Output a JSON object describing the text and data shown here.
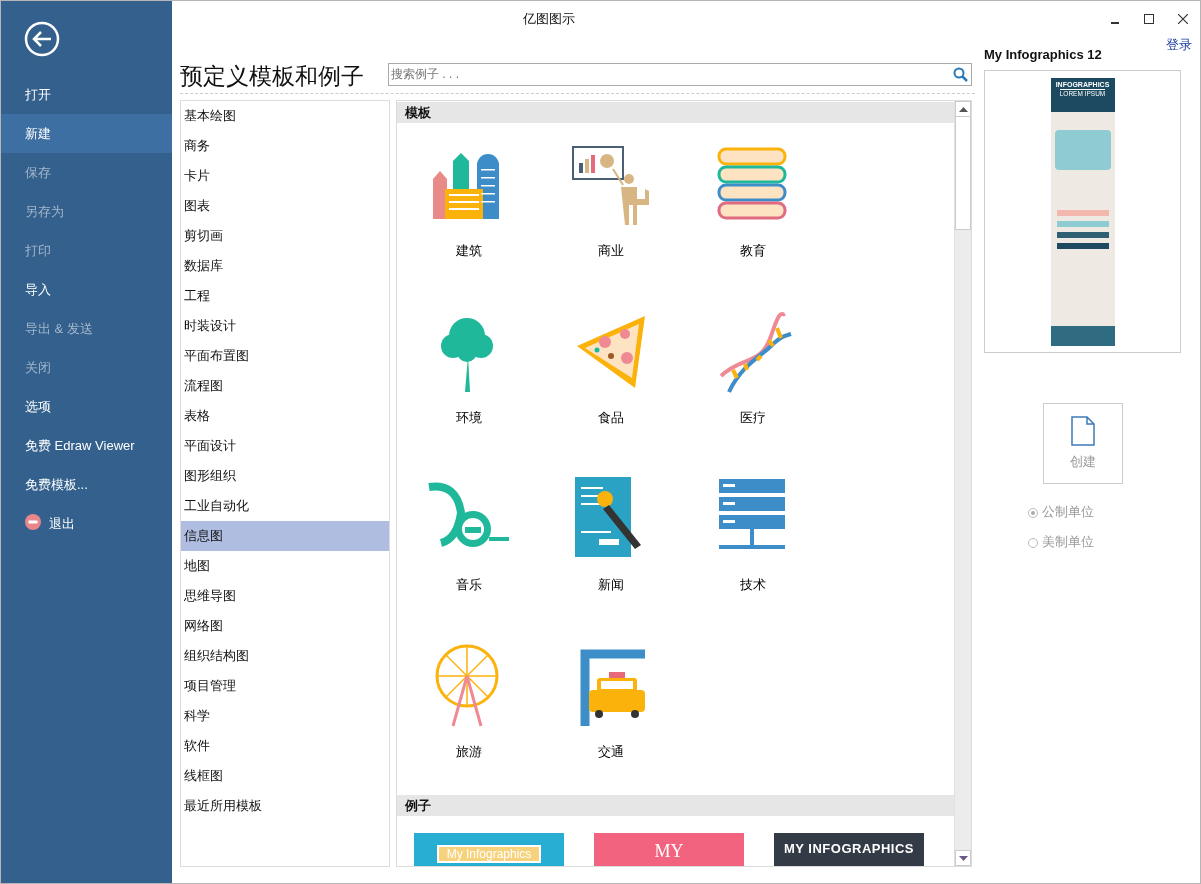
{
  "window": {
    "title": "亿图图示",
    "login": "登录"
  },
  "nav": [
    {
      "label": "打开",
      "selected": false,
      "disabled": false,
      "kind": "item"
    },
    {
      "label": "新建",
      "selected": true,
      "disabled": false,
      "kind": "item"
    },
    {
      "label": "保存",
      "selected": false,
      "disabled": true,
      "kind": "item"
    },
    {
      "label": "另存为",
      "selected": false,
      "disabled": true,
      "kind": "item"
    },
    {
      "label": "打印",
      "selected": false,
      "disabled": true,
      "kind": "item"
    },
    {
      "label": "导入",
      "selected": false,
      "disabled": false,
      "kind": "item"
    },
    {
      "label": "导出 & 发送",
      "selected": false,
      "disabled": true,
      "kind": "item"
    },
    {
      "label": "关闭",
      "selected": false,
      "disabled": true,
      "kind": "item"
    },
    {
      "label": "选项",
      "selected": false,
      "disabled": false,
      "kind": "item"
    },
    {
      "label": "免费 Edraw Viewer",
      "selected": false,
      "disabled": false,
      "kind": "item"
    },
    {
      "label": "免费模板...",
      "selected": false,
      "disabled": false,
      "kind": "item"
    },
    {
      "label": "退出",
      "selected": false,
      "disabled": false,
      "kind": "exit"
    }
  ],
  "heading": "预定义模板和例子",
  "search": {
    "placeholder": "搜索例子 . . ."
  },
  "categories": [
    {
      "label": "基本绘图",
      "selected": false
    },
    {
      "label": "商务",
      "selected": false
    },
    {
      "label": "卡片",
      "selected": false
    },
    {
      "label": "图表",
      "selected": false
    },
    {
      "label": "剪切画",
      "selected": false
    },
    {
      "label": "数据库",
      "selected": false
    },
    {
      "label": "工程",
      "selected": false
    },
    {
      "label": "时装设计",
      "selected": false
    },
    {
      "label": "平面布置图",
      "selected": false
    },
    {
      "label": "流程图",
      "selected": false
    },
    {
      "label": "表格",
      "selected": false
    },
    {
      "label": "平面设计",
      "selected": false
    },
    {
      "label": "图形组织",
      "selected": false
    },
    {
      "label": "工业自动化",
      "selected": false
    },
    {
      "label": "信息图",
      "selected": true
    },
    {
      "label": "地图",
      "selected": false
    },
    {
      "label": "思维导图",
      "selected": false
    },
    {
      "label": "网络图",
      "selected": false
    },
    {
      "label": "组织结构图",
      "selected": false
    },
    {
      "label": "项目管理",
      "selected": false
    },
    {
      "label": "科学",
      "selected": false
    },
    {
      "label": "软件",
      "selected": false
    },
    {
      "label": "线框图",
      "selected": false
    },
    {
      "label": "最近所用模板",
      "selected": false
    }
  ],
  "templates": {
    "title": "模板",
    "items": [
      {
        "label": "建筑",
        "kind": "buildings"
      },
      {
        "label": "商业",
        "kind": "presenter"
      },
      {
        "label": "教育",
        "kind": "books"
      },
      {
        "label": "环境",
        "kind": "tree"
      },
      {
        "label": "食品",
        "kind": "pizza"
      },
      {
        "label": "医疗",
        "kind": "dna"
      },
      {
        "label": "音乐",
        "kind": "horn"
      },
      {
        "label": "新闻",
        "kind": "microphone"
      },
      {
        "label": "技术",
        "kind": "server"
      },
      {
        "label": "旅游",
        "kind": "ferris"
      },
      {
        "label": "交通",
        "kind": "taxi"
      }
    ]
  },
  "examples": {
    "title": "例子",
    "items": [
      {
        "kind": "banner",
        "text": "My Infographics"
      },
      {
        "kind": "ribbon",
        "text": "MY"
      },
      {
        "kind": "dark",
        "text": "MY INFOGRAPHICS"
      }
    ]
  },
  "preview": {
    "title": "My Infographics 12",
    "doc_title": "INFOGRAPHICS",
    "doc_subtitle": "LOREM IPSUM"
  },
  "create": {
    "label": "创建"
  },
  "units": [
    {
      "label": "公制单位",
      "selected": true
    },
    {
      "label": "美制单位",
      "selected": false
    }
  ]
}
